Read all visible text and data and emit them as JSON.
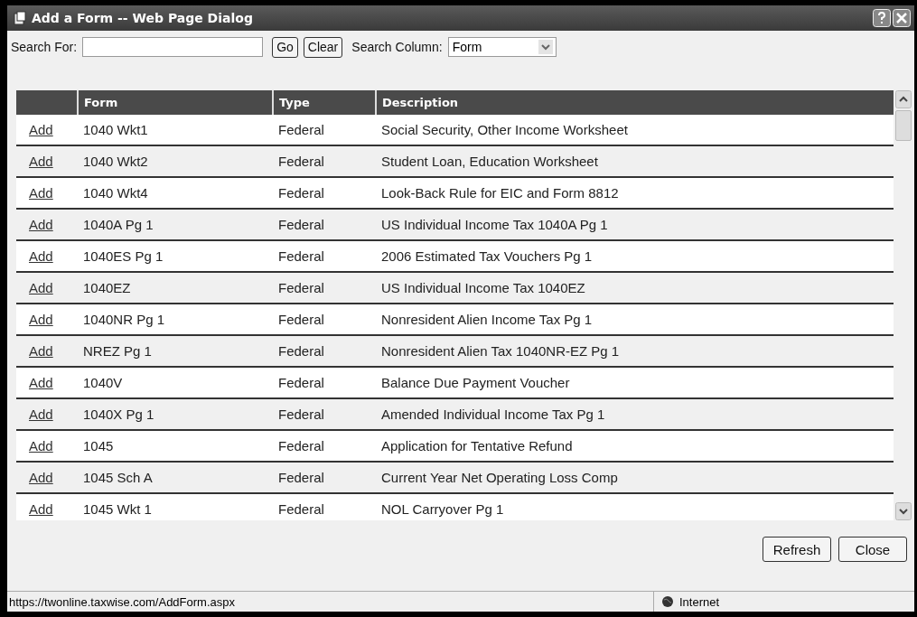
{
  "window": {
    "title": "Add a Form -- Web Page Dialog"
  },
  "search": {
    "label": "Search For:",
    "go": "Go",
    "clear": "Clear",
    "column_label": "Search Column:",
    "column_value": "Form"
  },
  "table": {
    "columns": [
      "",
      "Form",
      "Type",
      "Description"
    ],
    "rows": [
      {
        "action": "Add",
        "form": "1040 Wkt1",
        "type": "Federal",
        "description": "Social Security, Other Income Worksheet"
      },
      {
        "action": "Add",
        "form": "1040 Wkt2",
        "type": "Federal",
        "description": "Student Loan, Education Worksheet"
      },
      {
        "action": "Add",
        "form": "1040 Wkt4",
        "type": "Federal",
        "description": "Look-Back Rule for EIC and Form 8812"
      },
      {
        "action": "Add",
        "form": "1040A Pg 1",
        "type": "Federal",
        "description": "US Individual Income Tax 1040A Pg 1"
      },
      {
        "action": "Add",
        "form": "1040ES Pg 1",
        "type": "Federal",
        "description": "2006 Estimated Tax Vouchers Pg 1"
      },
      {
        "action": "Add",
        "form": "1040EZ",
        "type": "Federal",
        "description": "US Individual Income Tax 1040EZ"
      },
      {
        "action": "Add",
        "form": "1040NR Pg 1",
        "type": "Federal",
        "description": "Nonresident Alien Income Tax Pg 1"
      },
      {
        "action": "Add",
        "form": "NREZ Pg 1",
        "type": "Federal",
        "description": "Nonresident Alien Tax 1040NR-EZ Pg 1"
      },
      {
        "action": "Add",
        "form": "1040V",
        "type": "Federal",
        "description": "Balance Due Payment Voucher"
      },
      {
        "action": "Add",
        "form": "1040X Pg 1",
        "type": "Federal",
        "description": "Amended Individual Income Tax Pg 1"
      },
      {
        "action": "Add",
        "form": "1045",
        "type": "Federal",
        "description": "Application for Tentative Refund"
      },
      {
        "action": "Add",
        "form": "1045 Sch A",
        "type": "Federal",
        "description": "Current Year Net Operating Loss Comp"
      },
      {
        "action": "Add",
        "form": "1045 Wkt 1",
        "type": "Federal",
        "description": "NOL Carryover Pg 1"
      }
    ]
  },
  "buttons": [
    "Refresh",
    "Close"
  ],
  "status_bar": {
    "url": "https://twonline.taxwise.com/AddForm.aspx",
    "zone": "Internet"
  }
}
